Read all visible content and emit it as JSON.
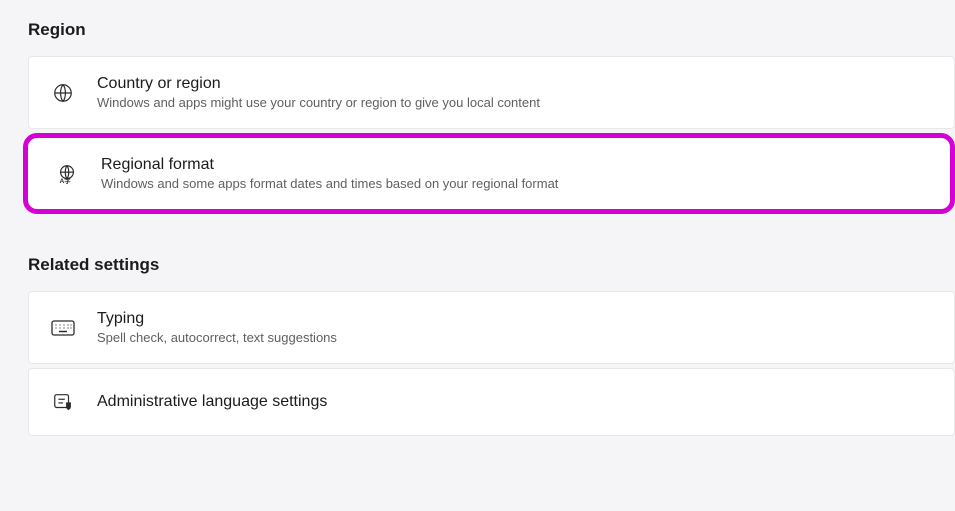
{
  "region": {
    "header": "Region",
    "items": [
      {
        "title": "Country or region",
        "subtitle": "Windows and apps might use your country or region to give you local content"
      },
      {
        "title": "Regional format",
        "subtitle": "Windows and some apps format dates and times based on your regional format"
      }
    ]
  },
  "related": {
    "header": "Related settings",
    "items": [
      {
        "title": "Typing",
        "subtitle": "Spell check, autocorrect, text suggestions"
      },
      {
        "title": "Administrative language settings",
        "subtitle": ""
      }
    ]
  }
}
